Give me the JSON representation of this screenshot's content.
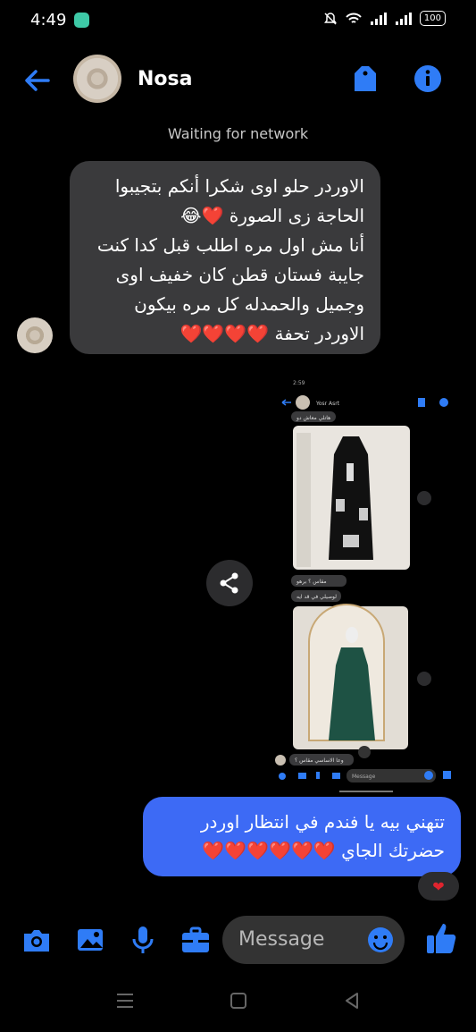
{
  "status_bar": {
    "time": "4:49",
    "battery": "100"
  },
  "header": {
    "name": "Nosa"
  },
  "network_status": "Waiting for network",
  "messages": {
    "received": {
      "lines": [
        "الاوردر حلو اوى شكرا أنكم بتجيبوا",
        "الحاجة زى الصورة ❤️😂",
        "أنا مش اول مره اطلب قبل كدا كنت",
        "جايبة فستان قطن كان خفيف اوى",
        "وجميل والحمدله كل مره بيكون",
        "الاوردر تحفة ❤️❤️❤️❤️"
      ]
    },
    "sent": {
      "lines": [
        "تتهني بيه يا فندم في انتظار اوردر",
        "حضرتك الجاي ❤️❤️❤️❤️❤️❤️"
      ],
      "reaction": "❤"
    }
  },
  "embedded_screenshot": {
    "time": "2:59",
    "header_name": "Yosr Asrt",
    "caption_top": "هاتلي معاش دو",
    "caption_1": "مقاس ؟ برهو",
    "caption_2": "لوصيلي في قد ايه",
    "caption_3": "وعا الاساسي مقاس ؟",
    "input_placeholder": "Message"
  },
  "composer": {
    "placeholder": "Message"
  },
  "colors": {
    "accent": "#3d6af5",
    "icon_blue": "#2f7cf6",
    "bubble_in": "#3a3a3c",
    "heart": "#e0242e"
  }
}
